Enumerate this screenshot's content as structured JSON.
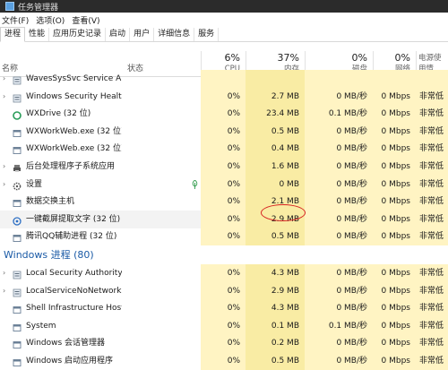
{
  "window": {
    "title": "任务管理器"
  },
  "menu": [
    "文件(F)",
    "选项(O)",
    "查看(V)"
  ],
  "tabs": [
    "进程",
    "性能",
    "应用历史记录",
    "启动",
    "用户",
    "详细信息",
    "服务"
  ],
  "header": {
    "name": "名称",
    "status": "状态",
    "cpu": {
      "pct": "6%",
      "label": "CPU"
    },
    "mem": {
      "pct": "37%",
      "label": "内存"
    },
    "disk": {
      "pct": "0%",
      "label": "磁盘"
    },
    "net": {
      "pct": "0%",
      "label": "网络"
    },
    "power": {
      "label": "电源使用情"
    }
  },
  "apps": [
    {
      "name": "WavesSysSvc Service Ap...",
      "cpu": "",
      "mem": "",
      "disk": "",
      "net": "",
      "power": "",
      "icon": "service-icon",
      "expand": true
    },
    {
      "name": "Windows Security Health...",
      "cpu": "0%",
      "mem": "2.7 MB",
      "disk": "0 MB/秒",
      "net": "0 Mbps",
      "power": "非常低",
      "icon": "service-icon",
      "expand": true
    },
    {
      "name": "WXDrive (32 位)",
      "cpu": "0%",
      "mem": "23.4 MB",
      "disk": "0.1 MB/秒",
      "net": "0 Mbps",
      "power": "非常低",
      "icon": "wxdrive-icon",
      "expand": false
    },
    {
      "name": "WXWorkWeb.exe (32 位)",
      "cpu": "0%",
      "mem": "0.5 MB",
      "disk": "0 MB/秒",
      "net": "0 Mbps",
      "power": "非常低",
      "icon": "app-window-icon",
      "expand": false
    },
    {
      "name": "WXWorkWeb.exe (32 位)",
      "cpu": "0%",
      "mem": "0.4 MB",
      "disk": "0 MB/秒",
      "net": "0 Mbps",
      "power": "非常低",
      "icon": "app-window-icon",
      "expand": false
    },
    {
      "name": "后台处理程序子系统应用",
      "cpu": "0%",
      "mem": "1.6 MB",
      "disk": "0 MB/秒",
      "net": "0 Mbps",
      "power": "非常低",
      "icon": "printer-icon",
      "expand": true
    },
    {
      "name": "设置",
      "cpu": "0%",
      "mem": "0 MB",
      "disk": "0 MB/秒",
      "net": "0 Mbps",
      "power": "非常低",
      "icon": "gear-icon",
      "expand": true,
      "suspended": true
    },
    {
      "name": "数据交换主机",
      "cpu": "0%",
      "mem": "2.1 MB",
      "disk": "0 MB/秒",
      "net": "0 Mbps",
      "power": "非常低",
      "icon": "app-window-icon",
      "expand": false
    },
    {
      "name": "一键截屏提取文字 (32 位)",
      "cpu": "0%",
      "mem": "2.9 MB",
      "disk": "0 MB/秒",
      "net": "0 Mbps",
      "power": "非常低",
      "icon": "screenshot-icon",
      "expand": false,
      "selected": true
    },
    {
      "name": "腾讯QQ辅助进程 (32 位)",
      "cpu": "0%",
      "mem": "0.5 MB",
      "disk": "0 MB/秒",
      "net": "0 Mbps",
      "power": "非常低",
      "icon": "app-window-icon",
      "expand": false
    }
  ],
  "group_title": "Windows 进程 (80)",
  "winprocs": [
    {
      "name": "Local Security Authority ...",
      "cpu": "0%",
      "mem": "4.3 MB",
      "disk": "0 MB/秒",
      "net": "0 Mbps",
      "power": "非常低",
      "icon": "service-icon",
      "expand": true
    },
    {
      "name": "LocalServiceNoNetwork...",
      "cpu": "0%",
      "mem": "2.9 MB",
      "disk": "0 MB/秒",
      "net": "0 Mbps",
      "power": "非常低",
      "icon": "service-icon",
      "expand": true
    },
    {
      "name": "Shell Infrastructure Host",
      "cpu": "0%",
      "mem": "4.3 MB",
      "disk": "0 MB/秒",
      "net": "0 Mbps",
      "power": "非常低",
      "icon": "app-window-icon",
      "expand": false
    },
    {
      "name": "System",
      "cpu": "0%",
      "mem": "0.1 MB",
      "disk": "0.1 MB/秒",
      "net": "0 Mbps",
      "power": "非常低",
      "icon": "app-window-icon",
      "expand": false
    },
    {
      "name": "Windows 会话管理器",
      "cpu": "0%",
      "mem": "0.2 MB",
      "disk": "0 MB/秒",
      "net": "0 Mbps",
      "power": "非常低",
      "icon": "app-window-icon",
      "expand": false
    },
    {
      "name": "Windows 启动应用程序",
      "cpu": "0%",
      "mem": "0.5 MB",
      "disk": "0 MB/秒",
      "net": "0 Mbps",
      "power": "非常低",
      "icon": "app-window-icon",
      "expand": false
    }
  ],
  "colors": {
    "highlight": "#fff4c3",
    "group": "#1a5aa6",
    "annotation": "#d62020"
  }
}
